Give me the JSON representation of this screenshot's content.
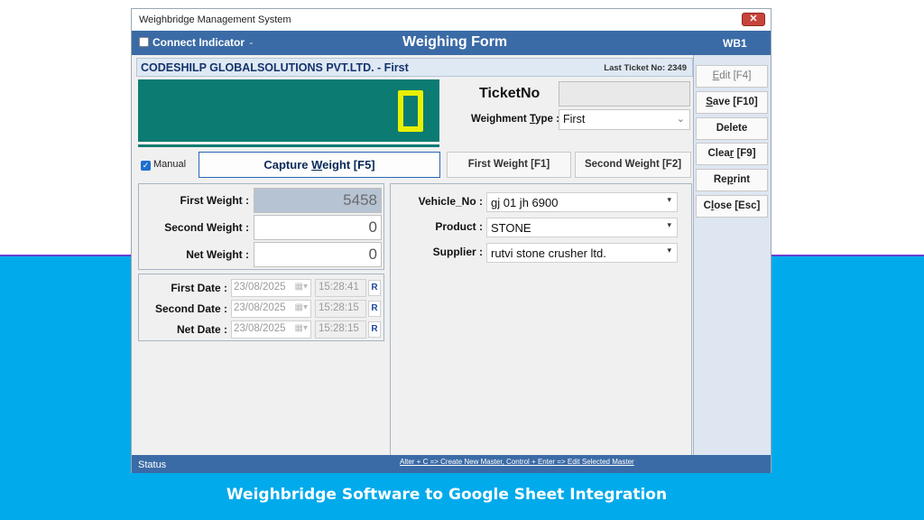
{
  "window": {
    "title": "Weighbridge Management System",
    "close_glyph": "✕"
  },
  "header": {
    "connect_label": "Connect Indicator",
    "connect_status": "-",
    "form_title": "Weighing Form",
    "station": "WB1"
  },
  "company": {
    "name": "CODESHILP GLOBALSOLUTIONS PVT.LTD. - First",
    "last_ticket": "Last Ticket No: 2349"
  },
  "indicator": {
    "display_value": "0",
    "color": "#e8f000",
    "background": "#0c7b72"
  },
  "ticket": {
    "label": "TicketNo",
    "value": "",
    "weighment_type_label_pre": "Weighment ",
    "weighment_type_label_u": "T",
    "weighment_type_label_post": "ype :",
    "weighment_type_value": "First"
  },
  "controls": {
    "manual_label": "Manual",
    "manual_checked": true,
    "capture_pre": "Capture ",
    "capture_u": "W",
    "capture_post": "eight [F5]",
    "first_weight_btn": "First Weight [F1]",
    "second_weight_btn": "Second Weight [F2]"
  },
  "weights": {
    "first_label": "First Weight :",
    "first_value": "5458",
    "second_label": "Second Weight :",
    "second_value": "0",
    "net_label": "Net Weight :",
    "net_value": "0"
  },
  "dates": {
    "rows": [
      {
        "label": "First Date :",
        "date": "23/08/2025",
        "time": "15:28:41",
        "r": "R"
      },
      {
        "label": "Second Date :",
        "date": "23/08/2025",
        "time": "15:28:15",
        "r": "R"
      },
      {
        "label": "Net Date :",
        "date": "23/08/2025",
        "time": "15:28:15",
        "r": "R"
      }
    ]
  },
  "fields": {
    "vehicle_label": "Vehicle_No :",
    "vehicle_value": "gj 01 jh 6900",
    "product_label": "Product :",
    "product_value": "STONE",
    "supplier_label": "Supplier :",
    "supplier_value": "rutvi stone crusher ltd."
  },
  "side": {
    "edit": {
      "u": "E",
      "rest": "dit [F4]"
    },
    "save": {
      "u": "S",
      "rest": "ave [F10]"
    },
    "delete": {
      "label": "Delete"
    },
    "clear": {
      "pre": "Clea",
      "u": "r",
      "rest": " [F9]"
    },
    "reprint": {
      "pre": "Re",
      "u": "p",
      "rest": "rint"
    },
    "close": {
      "pre": "C",
      "u": "l",
      "rest": "ose [Esc]"
    }
  },
  "status": {
    "label": "Status",
    "hint": "Alter + C => Create New Master, Control + Enter => Edit Selected Master"
  },
  "caption": "Weighbridge Software to Google Sheet Integration"
}
